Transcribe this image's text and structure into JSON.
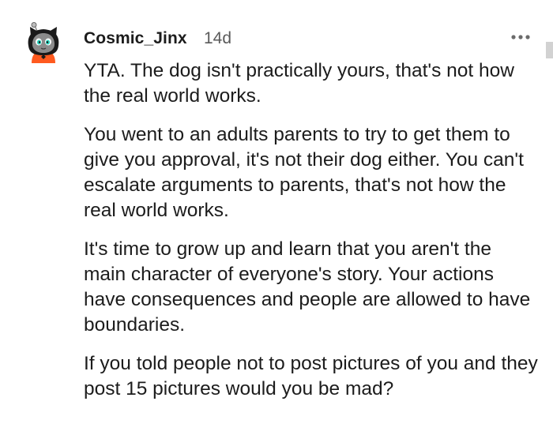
{
  "comment": {
    "author": "Cosmic_Jinx",
    "age": "14d",
    "avatar_icon": "cat-avatar-icon",
    "more_icon": "more-options-icon",
    "paragraphs": [
      "YTA. The dog isn't practically yours, that's not how the real world works.",
      "You went to an adults parents to try to get them to give you approval, it's not their dog either. You can't escalate arguments to parents, that's not how the real world works.",
      "It's time to grow up and learn that you aren't the main character of everyone's story. Your actions have consequences and people are allowed to have boundaries.",
      "If you told people not to post pictures of you and they post 15 pictures would you be mad?"
    ]
  },
  "colors": {
    "text": "#1c1c1c",
    "meta": "#5a5a5a",
    "avatar_accent": "#ff5a1f",
    "scrollbar": "#d2d2d2"
  }
}
